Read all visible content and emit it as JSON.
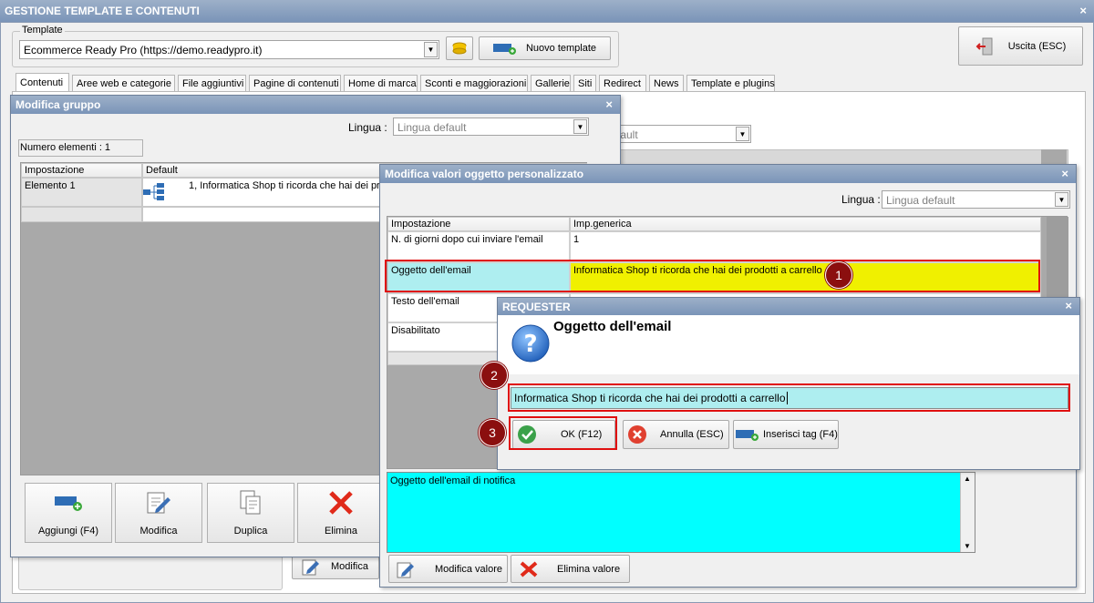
{
  "main": {
    "title": "GESTIONE TEMPLATE E CONTENUTI",
    "close": "×",
    "template_label": "Template",
    "template_value": "Ecommerce Ready Pro (https://demo.readypro.it)",
    "new_template": "Nuovo template",
    "exit": "Uscita (ESC)",
    "tabs": [
      "Contenuti",
      "Aree web e categorie",
      "File aggiuntivi",
      "Pagine di contenuti",
      "Home di marca",
      "Sconti e maggiorazioni",
      "Gallerie",
      "Siti",
      "Redirect",
      "News",
      "Template e plugins"
    ],
    "bg_combo": "fault",
    "bg_modifica": "Modifica"
  },
  "group": {
    "title": "Modifica gruppo",
    "close": "×",
    "lingua_label": "Lingua :",
    "lingua_value": "Lingua default",
    "count": "Numero elementi : 1",
    "col1": "Impostazione",
    "col2": "Default",
    "row_name": "Elemento 1",
    "row_value": "1, Informatica Shop ti ricorda che hai dei pro",
    "buttons": [
      "Aggiungi (F4)",
      "Modifica",
      "Duplica",
      "Elimina"
    ]
  },
  "custom": {
    "title": "Modifica valori oggetto personalizzato",
    "close": "×",
    "lingua_label": "Lingua :",
    "lingua_value": "Lingua default",
    "col1": "Impostazione",
    "col2": "Imp.generica",
    "rows": [
      {
        "name": "N. di giorni dopo cui inviare l'email",
        "value": "1"
      },
      {
        "name": "Oggetto dell'email",
        "value": "Informatica Shop ti ricorda che hai dei prodotti a carrello"
      },
      {
        "name": "Testo dell'email",
        "value": ""
      },
      {
        "name": "Disabilitato",
        "value": ""
      }
    ],
    "notify": "Oggetto dell'email di notifica",
    "edit_value": "Modifica valore",
    "delete_value": "Elimina valore"
  },
  "requester": {
    "title": "REQUESTER",
    "close": "×",
    "heading": "Oggetto dell'email",
    "input_value": "Informatica Shop ti ricorda che hai dei prodotti a carrello",
    "ok": "OK (F12)",
    "cancel": "Annulla (ESC)",
    "insert_tag": "Inserisci tag (F4)"
  },
  "badges": [
    "1",
    "2",
    "3"
  ],
  "colors": {
    "highlight_yellow": "#f0f000",
    "cyan": "#00ffff",
    "light_cyan": "#aeeef0",
    "badge": "#8b0f0f",
    "red_box": "#e01010"
  }
}
